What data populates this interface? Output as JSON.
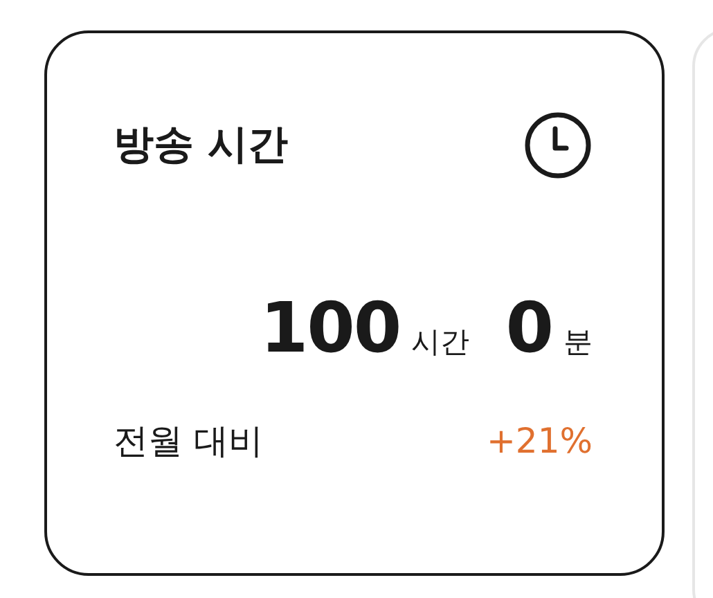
{
  "card": {
    "title": "방송 시간",
    "hours": "100",
    "hours_unit": "시간",
    "minutes": "0",
    "minutes_unit": "분",
    "compare_label": "전월 대비",
    "change": "+21%"
  }
}
